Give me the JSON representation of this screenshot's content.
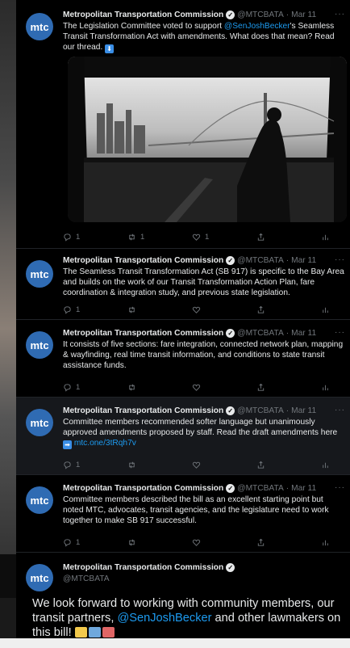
{
  "author": {
    "name": "Metropolitan Transportation Commission",
    "handle": "@MTCBATA",
    "avatar_text": "mtc",
    "verified_icon": "verified-check-icon"
  },
  "more_label": "···",
  "tweets": [
    {
      "date": "Mar 11",
      "text_pre": "The Legislation Committee voted to support ",
      "mention": "@SenJoshBecker",
      "text_post": "'s Seamless Transit Transformation Act with amendments. What does that mean? Read our thread.",
      "emoji": "⬇",
      "replies": "1",
      "retweets": "1",
      "likes": "1"
    },
    {
      "date": "Mar 11",
      "text": "The Seamless Transit Transformation Act (SB 917) is specific to the Bay Area and builds on the work of our Transit Transformation Action Plan, fare coordination & integration study, and previous state legislation.",
      "replies": "1"
    },
    {
      "date": "Mar 11",
      "text": "It consists of five sections: fare integration, connected network plan, mapping & wayfinding, real time transit information, and conditions to state transit assistance funds.",
      "replies": "1"
    },
    {
      "date": "Mar 11",
      "text": "Committee members recommended softer language but unanimously approved amendments proposed by staff. Read the draft amendments here",
      "link_emoji": "➡",
      "link": "mtc.one/3tRqh7v",
      "replies": "1"
    },
    {
      "date": "Mar 11",
      "text": "Committee members described the bill as an excellent starting point but noted MTC, advocates, transit agencies, and the legislature need to work together to make SB 917 successful.",
      "replies": "1"
    }
  ],
  "final_tweet": {
    "text_pre": "We look forward to working with community members, our transit partners, ",
    "mention": "@SenJoshBecker",
    "text_post": " and other lawmakers on this bill!",
    "emoji_colors": [
      "#f2c94c",
      "#6fa8dc",
      "#e06666"
    ]
  },
  "colors": {
    "background": "#000000",
    "text": "#e7e9ea",
    "muted": "#71767b",
    "link": "#1d9bf0",
    "avatar": "#2f6bb3"
  }
}
